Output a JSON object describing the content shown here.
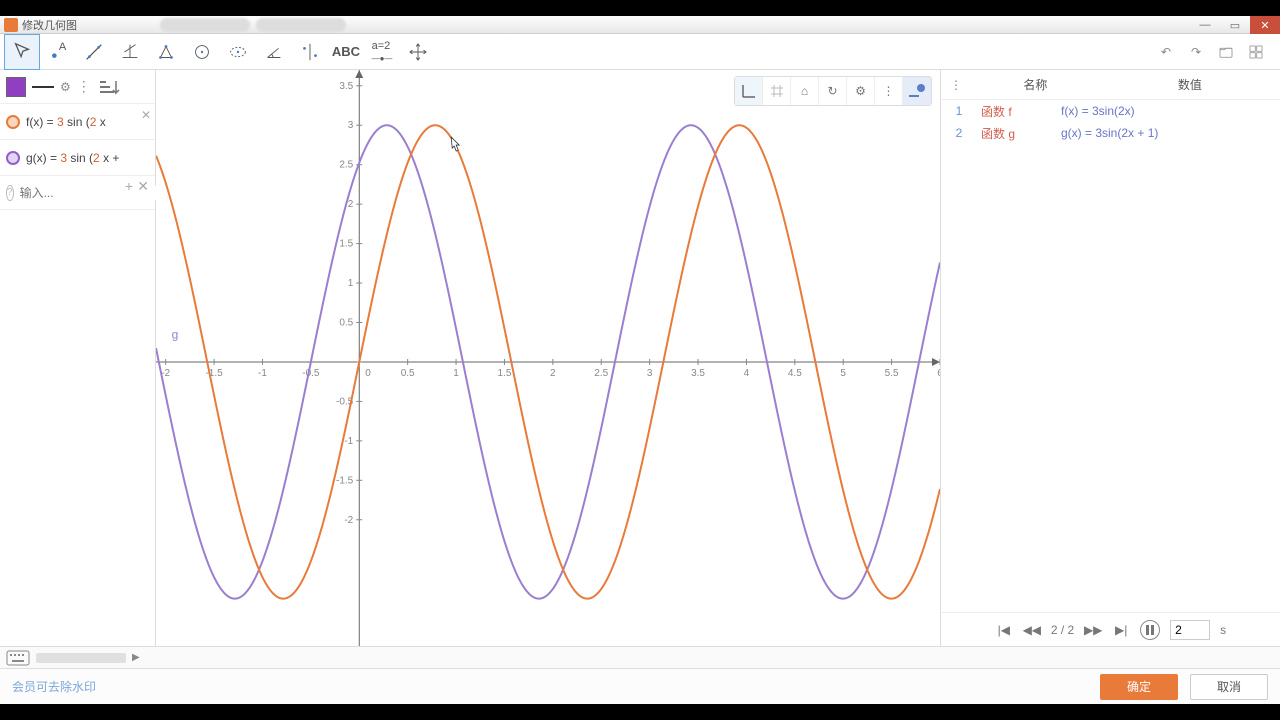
{
  "window": {
    "title": "修改几何图",
    "close": "✕",
    "max": "▭",
    "min": "—"
  },
  "toolbar_right": {
    "undo": "↶",
    "redo": "↷"
  },
  "left": {
    "f_label_pre": "f(x) = ",
    "f_num1": "3",
    "f_mid": " sin (",
    "f_num2": "2",
    "f_post": " x",
    "g_label_pre": "g(x) = ",
    "g_num1": "3",
    "g_mid": " sin (",
    "g_num2": "2",
    "g_post": " x +",
    "input_placeholder": "输入..."
  },
  "right": {
    "col_name": "名称",
    "col_value": "数值",
    "rows": [
      {
        "idx": "1",
        "name": "函数 f",
        "value": "f(x) = 3sin(2x)"
      },
      {
        "idx": "2",
        "name": "函数 g",
        "value": "g(x) = 3sin(2x + 1)"
      }
    ],
    "page": "2 / 2",
    "time_value": "2",
    "time_unit": "s"
  },
  "footer": {
    "watermark": "会员可去除水印",
    "ok": "确定",
    "cancel": "取消"
  },
  "graph_toolbar": {
    "home": "⌂",
    "reload": "↻",
    "gear": "⚙",
    "menu": "⋮"
  },
  "chart_data": {
    "type": "line",
    "title": "",
    "xlabel": "",
    "ylabel": "",
    "xlim": [
      -2.1,
      6.0
    ],
    "ylim": [
      -3.6,
      3.7
    ],
    "xticks": [
      -2,
      -1.5,
      -1,
      -0.5,
      0,
      0.5,
      1,
      1.5,
      2,
      2.5,
      3,
      3.5,
      4,
      4.5,
      5,
      5.5,
      6
    ],
    "yticks": [
      -2,
      -1.5,
      -1,
      -0.5,
      0,
      0.5,
      1,
      1.5,
      2,
      2.5,
      3,
      3.5
    ],
    "series": [
      {
        "name": "f",
        "formula": "3*sin(2*x)",
        "color": "#e87a3a"
      },
      {
        "name": "g",
        "formula": "3*sin(2*x+1)",
        "color": "#9a7fd0"
      }
    ],
    "g_label_pos": {
      "x": -2.0,
      "y": 0.3
    }
  }
}
